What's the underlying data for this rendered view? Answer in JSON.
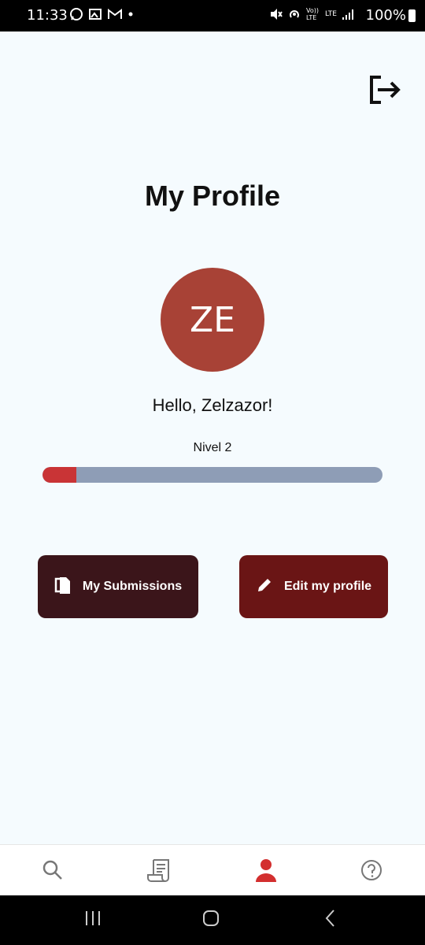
{
  "status_bar": {
    "time": "11:33",
    "battery": "100%",
    "icons_left": [
      "whatsapp-icon",
      "gallery-icon",
      "gmail-icon",
      "dot-icon"
    ],
    "icons_right": [
      "mute-icon",
      "hotspot-icon",
      "volte-icon",
      "lte-icon",
      "signal-icon"
    ],
    "volte_text": "Vo)) LTE",
    "lte_text": "LTE"
  },
  "header": {
    "logout_icon": "logout-icon"
  },
  "profile": {
    "title": "My Profile",
    "initials": "ZE",
    "greeting": "Hello, Zelzazor!",
    "level_label": "Nivel 2",
    "progress_fraction": 0.1,
    "avatar_color": "#a84236"
  },
  "actions": {
    "submissions_label": "My Submissions",
    "edit_label": "Edit my profile",
    "submissions_color": "#3b151a",
    "edit_color": "#6a1515"
  },
  "bottom_nav": {
    "items": [
      "search-icon",
      "submissions-icon",
      "profile-icon",
      "help-icon"
    ],
    "active": "profile-icon",
    "active_color": "#d32f2f",
    "inactive_color": "#777777"
  },
  "colors": {
    "background": "#f5fbfe",
    "progress_track": "#8e9db6",
    "progress_fill": "#c93436"
  }
}
